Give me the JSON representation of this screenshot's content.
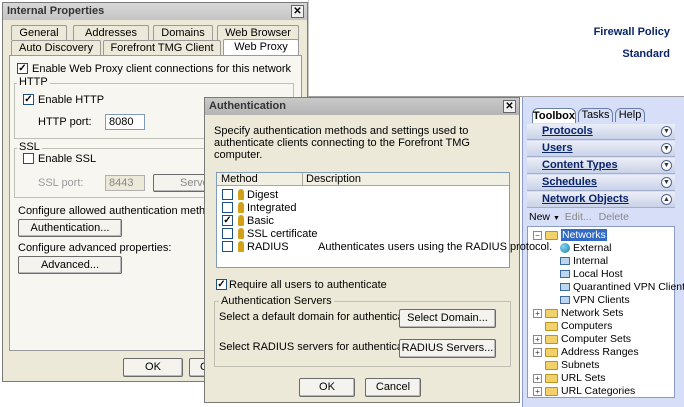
{
  "main_window": {
    "title": "Firewall Policy",
    "subtitle": "Standard"
  },
  "internal_properties": {
    "title": "Internal Properties",
    "close": "✕",
    "tabs_row1": [
      "General",
      "Addresses",
      "Domains",
      "Web Browser"
    ],
    "tabs_row2": [
      "Auto Discovery",
      "Forefront TMG Client",
      "Web Proxy"
    ],
    "enable_proxy_label": "Enable Web Proxy client connections for this network",
    "http_group": "HTTP",
    "enable_http_label": "Enable HTTP",
    "http_port_label": "HTTP port:",
    "http_port_value": "8080",
    "ssl_group": "SSL",
    "enable_ssl_label": "Enable SSL",
    "ssl_port_label": "SSL port:",
    "ssl_port_value": "8443",
    "server_button": "Server",
    "allowed_methods_label": "Configure allowed authentication methods:",
    "authentication_button": "Authentication...",
    "advanced_label": "Configure advanced properties:",
    "advanced_button": "Advanced...",
    "ok_button": "OK",
    "cancel_partial": "C"
  },
  "authentication_dialog": {
    "title": "Authentication",
    "close": "✕",
    "description": "Specify authentication methods and settings used to authenticate clients connecting to the Forefront TMG computer.",
    "col_method": "Method",
    "col_description": "Description",
    "methods": [
      {
        "name": "Digest",
        "checked": false,
        "description": ""
      },
      {
        "name": "Integrated",
        "checked": false,
        "description": ""
      },
      {
        "name": "Basic",
        "checked": true,
        "description": ""
      },
      {
        "name": "SSL certificate",
        "checked": false,
        "description": ""
      },
      {
        "name": "RADIUS",
        "checked": false,
        "description": "Authenticates users using the RADIUS protocol."
      }
    ],
    "require_all_label": "Require all users to authenticate",
    "servers_group": "Authentication Servers",
    "default_domain_label": "Select a default domain for authentication:",
    "select_domain_button": "Select Domain...",
    "radius_label": "Select RADIUS servers for authentication:",
    "radius_button": "RADIUS Servers...",
    "ok_button": "OK",
    "cancel_button": "Cancel"
  },
  "toolbox": {
    "tabs": [
      "Toolbox",
      "Tasks",
      "Help"
    ],
    "sections": [
      "Protocols",
      "Users",
      "Content Types",
      "Schedules",
      "Network Objects"
    ],
    "toolbar": {
      "new": "New",
      "edit": "Edit...",
      "delete": "Delete"
    },
    "tree": [
      {
        "label": "Networks",
        "level": 0,
        "icon": "folder-open-icon",
        "selected": true
      },
      {
        "label": "External",
        "level": 1,
        "icon": "globe-icon"
      },
      {
        "label": "Internal",
        "level": 1,
        "icon": "network-icon"
      },
      {
        "label": "Local Host",
        "level": 1,
        "icon": "network-icon"
      },
      {
        "label": "Quarantined VPN Clients",
        "level": 1,
        "icon": "network-icon"
      },
      {
        "label": "VPN Clients",
        "level": 1,
        "icon": "vpn-icon"
      },
      {
        "label": "Network Sets",
        "level": 0,
        "icon": "folder-icon"
      },
      {
        "label": "Computers",
        "level": 0,
        "icon": "folder-icon"
      },
      {
        "label": "Computer Sets",
        "level": 0,
        "icon": "folder-icon"
      },
      {
        "label": "Address Ranges",
        "level": 0,
        "icon": "folder-icon"
      },
      {
        "label": "Subnets",
        "level": 0,
        "icon": "folder-icon"
      },
      {
        "label": "URL Sets",
        "level": 0,
        "icon": "folder-icon"
      },
      {
        "label": "URL Categories",
        "level": 0,
        "icon": "folder-icon"
      }
    ]
  },
  "colors": {
    "dialog_bg": "#ece9d8",
    "toolbox_bg": "#d6dff7",
    "header_text": "#0a246a"
  }
}
